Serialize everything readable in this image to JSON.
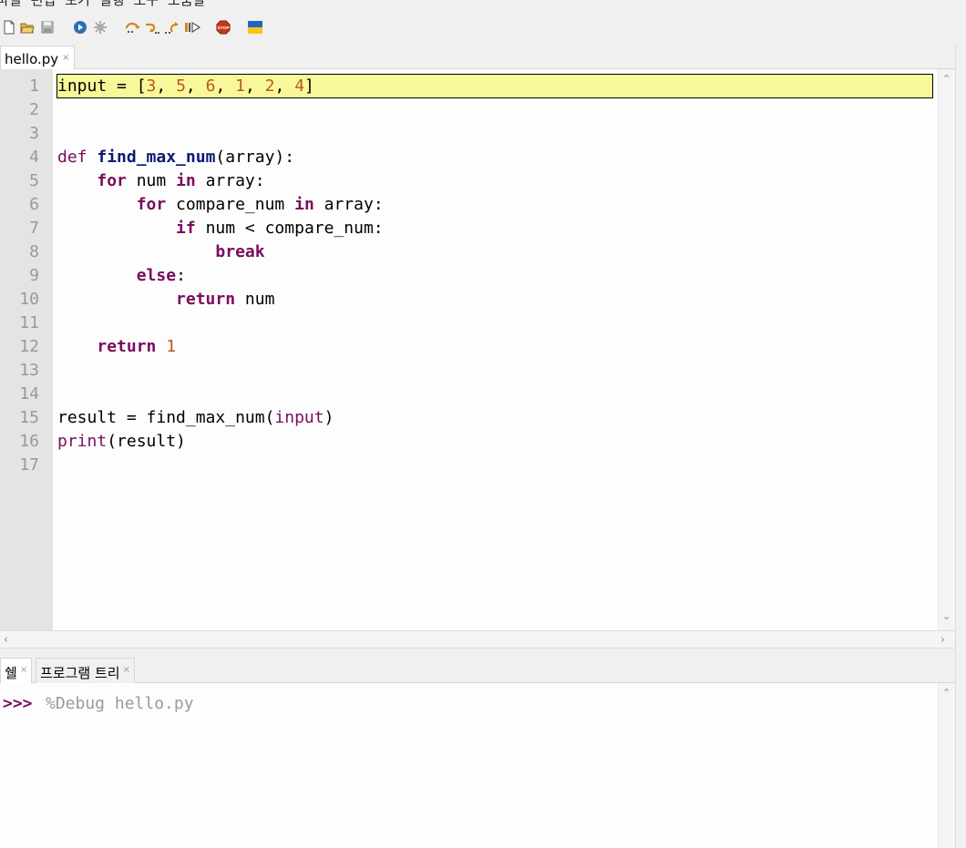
{
  "menu": [
    "파일",
    "편집",
    "보기",
    "실행",
    "도구",
    "도움말"
  ],
  "toolbar": {
    "icons": [
      "new-file-icon",
      "open-file-icon",
      "save-icon",
      "run-icon",
      "debug-icon",
      "step-over-icon",
      "step-into-icon",
      "step-out-icon",
      "resume-icon",
      "stop-icon",
      "ukraine-flag-icon"
    ],
    "stop_label": "STOP"
  },
  "editor": {
    "tab_title": "hello.py",
    "tab_close": "×",
    "line_numbers": [
      "1",
      "2",
      "3",
      "4",
      "5",
      "6",
      "7",
      "8",
      "9",
      "10",
      "11",
      "12",
      "13",
      "14",
      "15",
      "16",
      "17"
    ],
    "lines": [
      "input = [3, 5, 6, 1, 2, 4]",
      "",
      "",
      "def find_max_num(array):",
      "    for num in array:",
      "        for compare_num in array:",
      "            if num < compare_num:",
      "                break",
      "        else:",
      "            return num",
      "",
      "    return 1",
      "",
      "",
      "result = find_max_num(input)",
      "print(result)",
      ""
    ],
    "highlighted_line": 1
  },
  "panel": {
    "tabs": [
      {
        "label": "쉘",
        "close": "×"
      },
      {
        "label": "프로그램 트리",
        "close": "×"
      }
    ]
  },
  "shell": {
    "prompt": ">>>",
    "command": "%Debug hello.py"
  },
  "colors": {
    "keyword": "#7a0b5e",
    "number": "#b8581c",
    "function_name": "#0a1a75",
    "highlight": "#f8f89a",
    "gutter": "#e4e4e4"
  }
}
